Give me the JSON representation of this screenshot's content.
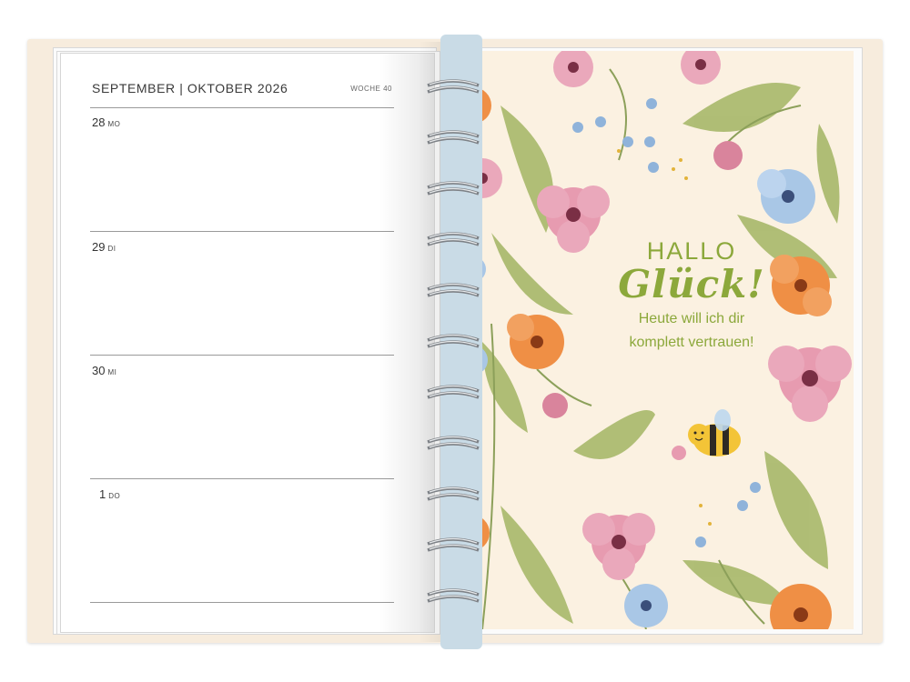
{
  "planner": {
    "month_left": "SEPTEMBER",
    "month_separator": "|",
    "month_right": "OKTOBER 2026",
    "week_label": "WOCHE 40",
    "days": [
      {
        "num": "28",
        "abbr": "MO"
      },
      {
        "num": "29",
        "abbr": "DI"
      },
      {
        "num": "30",
        "abbr": "MI"
      },
      {
        "num": "1",
        "abbr": "DO"
      }
    ]
  },
  "cover_page": {
    "line1": "HALLO",
    "line2": "Glück!",
    "line3": "Heute will ich dir",
    "line4": "komplett vertrauen!"
  },
  "colors": {
    "cover_bg": "#fbf1e1",
    "accent_green": "#8ca83b",
    "binder_blue": "#c9dbe6",
    "flower_pink": "#e79bb0",
    "flower_orange": "#ef8f45",
    "flower_blue": "#a9c7e6",
    "leaf_green": "#a7b86a"
  }
}
